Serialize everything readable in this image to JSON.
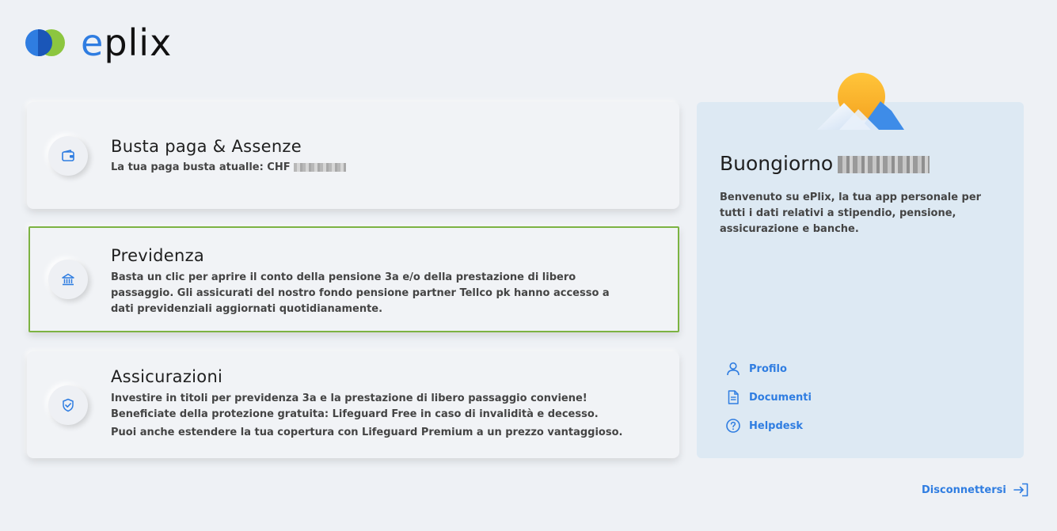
{
  "brand": {
    "logo_prefix": "e",
    "logo_rest": "plix"
  },
  "cards": [
    {
      "title": "Busta paga & Assenze",
      "text": "La tua paga busta atualle: CHF",
      "icon": "wallet-icon"
    },
    {
      "title": "Previdenza",
      "text": "Basta un clic per aprire il conto della pensione 3a e/o della prestazione di libero passaggio. Gli assicurati del nostro fondo pensione partner Tellco pk hanno accesso a dati previdenziali aggiornati quotidianamente.",
      "icon": "bank-icon"
    },
    {
      "title": "Assicurazioni",
      "text": "Investire in titoli per previdenza 3a e la prestazione di libero passaggio conviene! Beneficiate della protezione gratuita: Lifeguard Free in caso di invalidità e decesso.",
      "text2": "Puoi anche estendere la tua copertura con Lifeguard Premium a un prezzo vantaggioso.",
      "icon": "shield-check-icon"
    }
  ],
  "sidebar": {
    "greeting": "Buongiorno",
    "intro": "Benvenuto su ePlix, la tua app personale per tutti i dati relativi a stipendio, pensione, assicurazione e banche.",
    "links": [
      {
        "label": "Profilo",
        "icon": "user-icon"
      },
      {
        "label": "Documenti",
        "icon": "document-icon"
      },
      {
        "label": "Helpdesk",
        "icon": "help-icon"
      }
    ]
  },
  "logout": {
    "label": "Disconnettersi",
    "icon": "logout-icon"
  },
  "colors": {
    "accent": "#2f7de1",
    "brand_green": "#8cc63f",
    "selected_border": "#7cb342",
    "panel_bg": "#dde9f3"
  }
}
